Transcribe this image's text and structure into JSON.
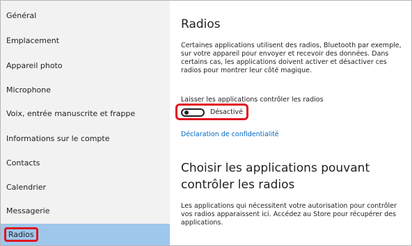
{
  "sidebar": {
    "items": [
      {
        "label": "Général"
      },
      {
        "label": "Emplacement"
      },
      {
        "label": "Appareil photo"
      },
      {
        "label": "Microphone"
      },
      {
        "label": "Voix, entrée manuscrite et frappe"
      },
      {
        "label": "Informations sur le compte"
      },
      {
        "label": "Contacts"
      },
      {
        "label": "Calendrier"
      },
      {
        "label": "Messagerie"
      },
      {
        "label": "Radios"
      }
    ],
    "selected": "Radios"
  },
  "main": {
    "title": "Radios",
    "description": "Certaines applications utilisent des radios, Bluetooth par exemple, sur votre appareil pour envoyer et recevoir des données. Dans certains cas, les applications doivent activer et désactiver ces radios pour montrer leur côté magique.",
    "toggle_label": "Laisser les applications contrôler les radios",
    "toggle_state": "Désactivé",
    "toggle_on": false,
    "privacy_link": "Déclaration de confidentialité",
    "section_title": "Choisir les applications pouvant contrôler les radios",
    "section_description": "Les applications qui nécessitent votre autorisation pour contrôler vos radios apparaissent ici. Accédez au Store pour récupérer des applications."
  },
  "colors": {
    "sidebar_bg": "#f2f2f2",
    "selected_bg": "#9ec7ec",
    "highlight": "#e0141e",
    "link": "#0067c0"
  }
}
